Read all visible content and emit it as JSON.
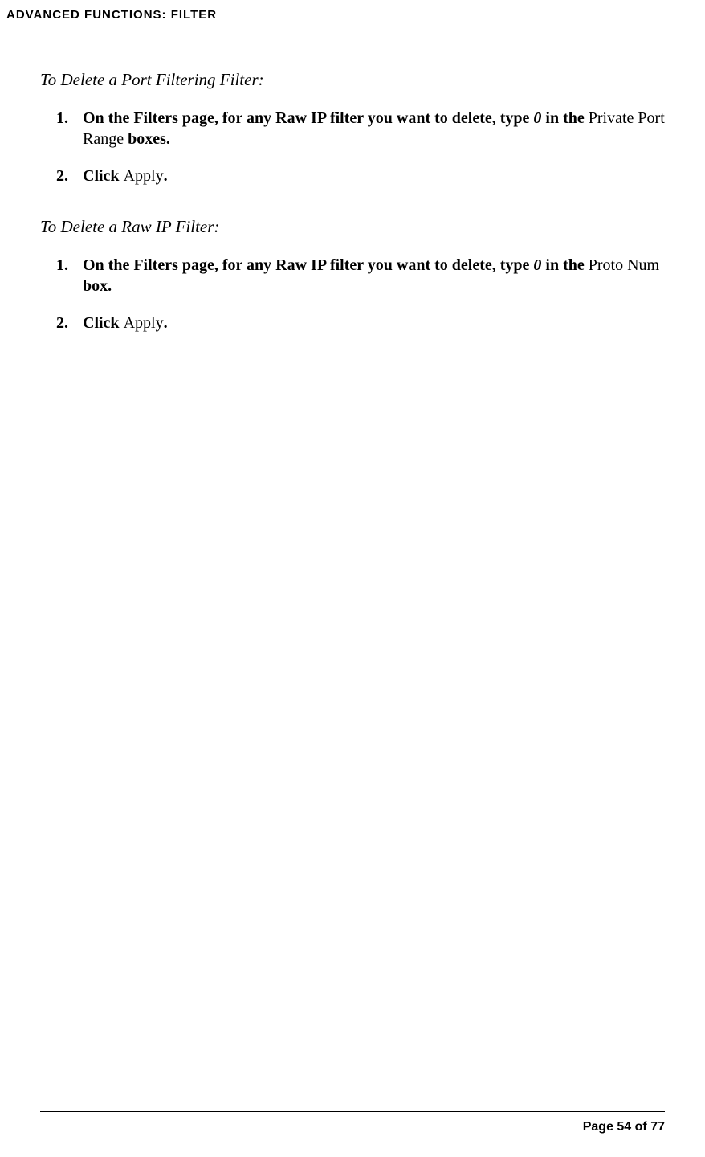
{
  "header": {
    "title": "ADVANCED FUNCTIONS: FILTER"
  },
  "sections": [
    {
      "title": "To Delete a Port Filtering Filter:",
      "items": [
        {
          "num": "1.",
          "runs": [
            {
              "text": "On the Filters page, for any Raw IP filter you want to delete, type ",
              "style": "bold"
            },
            {
              "text": "0",
              "style": "italic-bold"
            },
            {
              "text": " in the ",
              "style": "bold"
            },
            {
              "text": "Private Port Range",
              "style": ""
            },
            {
              "text": " boxes.",
              "style": "bold"
            }
          ]
        },
        {
          "num": "2.",
          "runs": [
            {
              "text": "Click ",
              "style": "bold"
            },
            {
              "text": "Apply",
              "style": ""
            },
            {
              "text": ".",
              "style": "bold"
            }
          ]
        }
      ]
    },
    {
      "title": "To Delete a Raw IP Filter:",
      "items": [
        {
          "num": "1.",
          "runs": [
            {
              "text": "On the Filters page, for any Raw IP filter you want to delete, type ",
              "style": "bold"
            },
            {
              "text": "0",
              "style": "italic-bold"
            },
            {
              "text": " in the ",
              "style": "bold"
            },
            {
              "text": "Proto Num",
              "style": ""
            },
            {
              "text": " box.",
              "style": "bold"
            }
          ]
        },
        {
          "num": "2.",
          "runs": [
            {
              "text": "Click ",
              "style": "bold"
            },
            {
              "text": "Apply",
              "style": ""
            },
            {
              "text": ".",
              "style": "bold"
            }
          ]
        }
      ]
    }
  ],
  "footer": {
    "page_label": "Page 54 of 77"
  }
}
